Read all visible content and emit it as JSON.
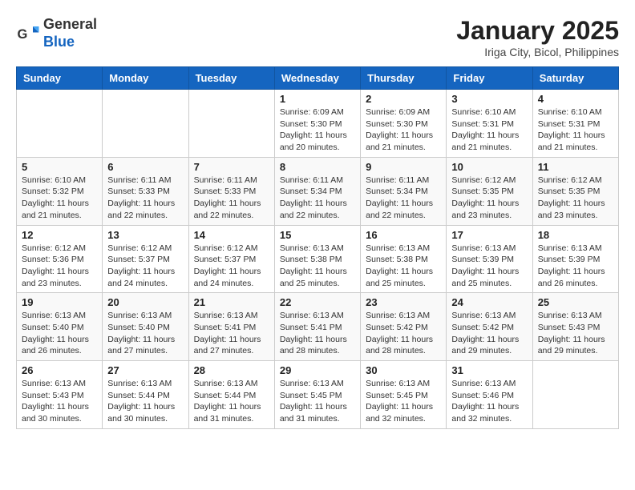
{
  "header": {
    "logo_general": "General",
    "logo_blue": "Blue",
    "title": "January 2025",
    "subtitle": "Iriga City, Bicol, Philippines"
  },
  "weekdays": [
    "Sunday",
    "Monday",
    "Tuesday",
    "Wednesday",
    "Thursday",
    "Friday",
    "Saturday"
  ],
  "weeks": [
    [
      {
        "day": "",
        "info": ""
      },
      {
        "day": "",
        "info": ""
      },
      {
        "day": "",
        "info": ""
      },
      {
        "day": "1",
        "info": "Sunrise: 6:09 AM\nSunset: 5:30 PM\nDaylight: 11 hours and 20 minutes."
      },
      {
        "day": "2",
        "info": "Sunrise: 6:09 AM\nSunset: 5:30 PM\nDaylight: 11 hours and 21 minutes."
      },
      {
        "day": "3",
        "info": "Sunrise: 6:10 AM\nSunset: 5:31 PM\nDaylight: 11 hours and 21 minutes."
      },
      {
        "day": "4",
        "info": "Sunrise: 6:10 AM\nSunset: 5:31 PM\nDaylight: 11 hours and 21 minutes."
      }
    ],
    [
      {
        "day": "5",
        "info": "Sunrise: 6:10 AM\nSunset: 5:32 PM\nDaylight: 11 hours and 21 minutes."
      },
      {
        "day": "6",
        "info": "Sunrise: 6:11 AM\nSunset: 5:33 PM\nDaylight: 11 hours and 22 minutes."
      },
      {
        "day": "7",
        "info": "Sunrise: 6:11 AM\nSunset: 5:33 PM\nDaylight: 11 hours and 22 minutes."
      },
      {
        "day": "8",
        "info": "Sunrise: 6:11 AM\nSunset: 5:34 PM\nDaylight: 11 hours and 22 minutes."
      },
      {
        "day": "9",
        "info": "Sunrise: 6:11 AM\nSunset: 5:34 PM\nDaylight: 11 hours and 22 minutes."
      },
      {
        "day": "10",
        "info": "Sunrise: 6:12 AM\nSunset: 5:35 PM\nDaylight: 11 hours and 23 minutes."
      },
      {
        "day": "11",
        "info": "Sunrise: 6:12 AM\nSunset: 5:35 PM\nDaylight: 11 hours and 23 minutes."
      }
    ],
    [
      {
        "day": "12",
        "info": "Sunrise: 6:12 AM\nSunset: 5:36 PM\nDaylight: 11 hours and 23 minutes."
      },
      {
        "day": "13",
        "info": "Sunrise: 6:12 AM\nSunset: 5:37 PM\nDaylight: 11 hours and 24 minutes."
      },
      {
        "day": "14",
        "info": "Sunrise: 6:12 AM\nSunset: 5:37 PM\nDaylight: 11 hours and 24 minutes."
      },
      {
        "day": "15",
        "info": "Sunrise: 6:13 AM\nSunset: 5:38 PM\nDaylight: 11 hours and 25 minutes."
      },
      {
        "day": "16",
        "info": "Sunrise: 6:13 AM\nSunset: 5:38 PM\nDaylight: 11 hours and 25 minutes."
      },
      {
        "day": "17",
        "info": "Sunrise: 6:13 AM\nSunset: 5:39 PM\nDaylight: 11 hours and 25 minutes."
      },
      {
        "day": "18",
        "info": "Sunrise: 6:13 AM\nSunset: 5:39 PM\nDaylight: 11 hours and 26 minutes."
      }
    ],
    [
      {
        "day": "19",
        "info": "Sunrise: 6:13 AM\nSunset: 5:40 PM\nDaylight: 11 hours and 26 minutes."
      },
      {
        "day": "20",
        "info": "Sunrise: 6:13 AM\nSunset: 5:40 PM\nDaylight: 11 hours and 27 minutes."
      },
      {
        "day": "21",
        "info": "Sunrise: 6:13 AM\nSunset: 5:41 PM\nDaylight: 11 hours and 27 minutes."
      },
      {
        "day": "22",
        "info": "Sunrise: 6:13 AM\nSunset: 5:41 PM\nDaylight: 11 hours and 28 minutes."
      },
      {
        "day": "23",
        "info": "Sunrise: 6:13 AM\nSunset: 5:42 PM\nDaylight: 11 hours and 28 minutes."
      },
      {
        "day": "24",
        "info": "Sunrise: 6:13 AM\nSunset: 5:42 PM\nDaylight: 11 hours and 29 minutes."
      },
      {
        "day": "25",
        "info": "Sunrise: 6:13 AM\nSunset: 5:43 PM\nDaylight: 11 hours and 29 minutes."
      }
    ],
    [
      {
        "day": "26",
        "info": "Sunrise: 6:13 AM\nSunset: 5:43 PM\nDaylight: 11 hours and 30 minutes."
      },
      {
        "day": "27",
        "info": "Sunrise: 6:13 AM\nSunset: 5:44 PM\nDaylight: 11 hours and 30 minutes."
      },
      {
        "day": "28",
        "info": "Sunrise: 6:13 AM\nSunset: 5:44 PM\nDaylight: 11 hours and 31 minutes."
      },
      {
        "day": "29",
        "info": "Sunrise: 6:13 AM\nSunset: 5:45 PM\nDaylight: 11 hours and 31 minutes."
      },
      {
        "day": "30",
        "info": "Sunrise: 6:13 AM\nSunset: 5:45 PM\nDaylight: 11 hours and 32 minutes."
      },
      {
        "day": "31",
        "info": "Sunrise: 6:13 AM\nSunset: 5:46 PM\nDaylight: 11 hours and 32 minutes."
      },
      {
        "day": "",
        "info": ""
      }
    ]
  ]
}
